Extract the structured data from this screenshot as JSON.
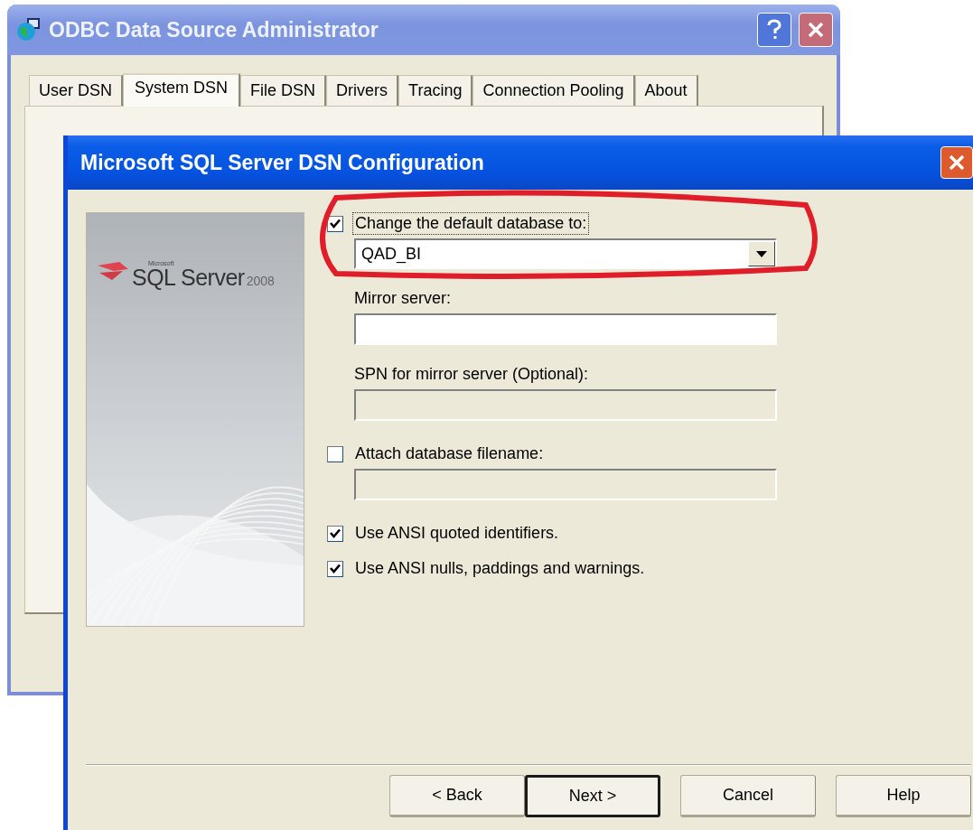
{
  "background_window": {
    "title": "ODBC Data Source Administrator",
    "tabs": [
      {
        "label": "User DSN",
        "selected": false
      },
      {
        "label": "System DSN",
        "selected": true
      },
      {
        "label": "File DSN",
        "selected": false
      },
      {
        "label": "Drivers",
        "selected": false
      },
      {
        "label": "Tracing",
        "selected": false
      },
      {
        "label": "Connection Pooling",
        "selected": false
      },
      {
        "label": "About",
        "selected": false
      }
    ]
  },
  "dialog": {
    "title": "Microsoft SQL Server DSN Configuration",
    "logo": {
      "maker": "Microsoft",
      "product": "SQL Server",
      "version": "2008"
    },
    "options": [
      {
        "kind": "checkbox",
        "label": "Change the default database to:",
        "checked": true,
        "focused": true
      },
      {
        "kind": "combo",
        "value": "QAD_BI"
      },
      {
        "kind": "label",
        "label": "Mirror server:"
      },
      {
        "kind": "field",
        "disabled": false
      },
      {
        "kind": "label",
        "label": "SPN for mirror server (Optional):"
      },
      {
        "kind": "field",
        "disabled": true
      },
      {
        "kind": "checkbox",
        "label": "Attach database filename:",
        "checked": false,
        "focused": false
      },
      {
        "kind": "field",
        "disabled": true
      },
      {
        "kind": "checkbox",
        "label": "Use ANSI quoted identifiers.",
        "checked": true,
        "focused": false
      },
      {
        "kind": "checkbox",
        "label": "Use ANSI nulls, paddings and warnings.",
        "checked": true,
        "focused": false
      }
    ],
    "buttons": [
      {
        "label": "< Back",
        "default": false
      },
      {
        "label": "Next >",
        "default": true
      },
      {
        "label": "Cancel",
        "default": false
      },
      {
        "label": "Help",
        "default": false
      }
    ]
  }
}
